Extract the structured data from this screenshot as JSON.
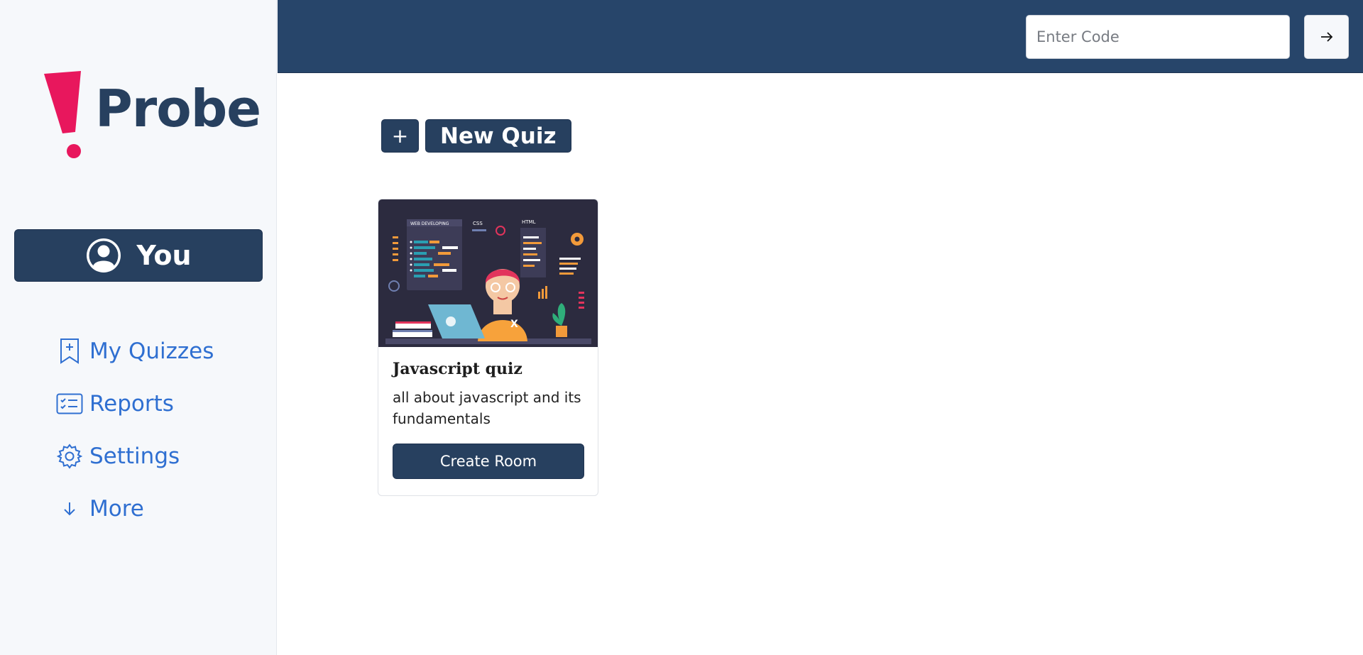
{
  "sidebar": {
    "logo_text": "Probe",
    "profile_label": "You",
    "nav": [
      {
        "label": "My Quizzes",
        "icon": "bookmark-plus-icon"
      },
      {
        "label": "Reports",
        "icon": "checklist-card-icon"
      },
      {
        "label": "Settings",
        "icon": "gear-icon"
      },
      {
        "label": "More",
        "icon": "arrow-down-icon"
      }
    ]
  },
  "topbar": {
    "code_placeholder": "Enter Code",
    "code_value": "",
    "submit_icon": "arrow-right-icon"
  },
  "main": {
    "add_icon_label": "+",
    "new_quiz_label": "New Quiz",
    "quizzes": [
      {
        "title": "Javascript quiz",
        "description": "all about javascript and its fundamentals",
        "action_label": "Create Room",
        "image_labels": [
          "WEB DEVELOPING",
          "CSS",
          "HTML"
        ]
      }
    ]
  },
  "colors": {
    "navy": "#27405f",
    "topbar": "#27456a",
    "accent_blue": "#2f6fd1",
    "logo_pink": "#e8175d"
  }
}
